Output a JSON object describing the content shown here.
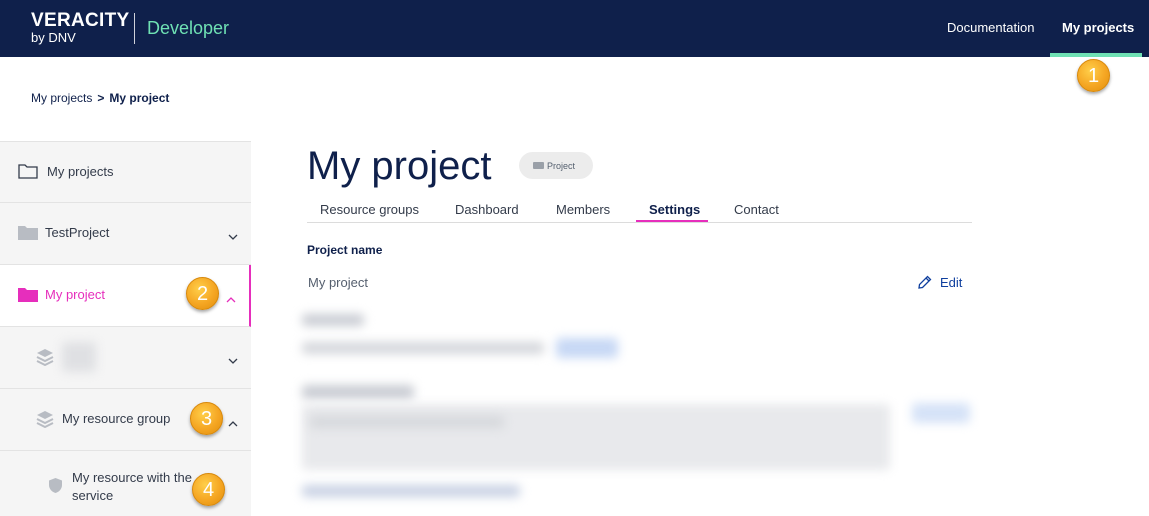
{
  "header": {
    "brand_main": "VERACITY",
    "brand_sub": "by DNV",
    "product": "Developer",
    "nav": [
      {
        "label": "Documentation"
      },
      {
        "label": "My projects"
      }
    ]
  },
  "callouts": [
    "1",
    "2",
    "3",
    "4"
  ],
  "breadcrumb": {
    "parent": "My projects",
    "separator": ">",
    "current": "My project"
  },
  "sidebar": {
    "items": [
      {
        "label": "My projects",
        "icon": "folder-outline-icon"
      },
      {
        "label": "TestProject",
        "icon": "folder-icon",
        "expanded": false
      },
      {
        "label": "My project",
        "icon": "folder-icon",
        "expanded": true,
        "active": true
      },
      {
        "label": "",
        "icon": "layers-icon",
        "expanded": false
      },
      {
        "label": "My resource group",
        "icon": "layers-icon",
        "expanded": true
      },
      {
        "label": "My resource with the service",
        "icon": "shield-icon"
      }
    ]
  },
  "main": {
    "title": "My project",
    "badge": "Project",
    "tabs": [
      {
        "label": "Resource groups"
      },
      {
        "label": "Dashboard"
      },
      {
        "label": "Members"
      },
      {
        "label": "Settings",
        "active": true
      },
      {
        "label": "Contact"
      }
    ],
    "project_name_label": "Project name",
    "project_name_value": "My project",
    "edit_label": "Edit"
  },
  "colors": {
    "header_bg": "#0f204b",
    "accent_green": "#6fe1b4",
    "accent_pink": "#e62ebc",
    "callout": "#f5a623"
  }
}
